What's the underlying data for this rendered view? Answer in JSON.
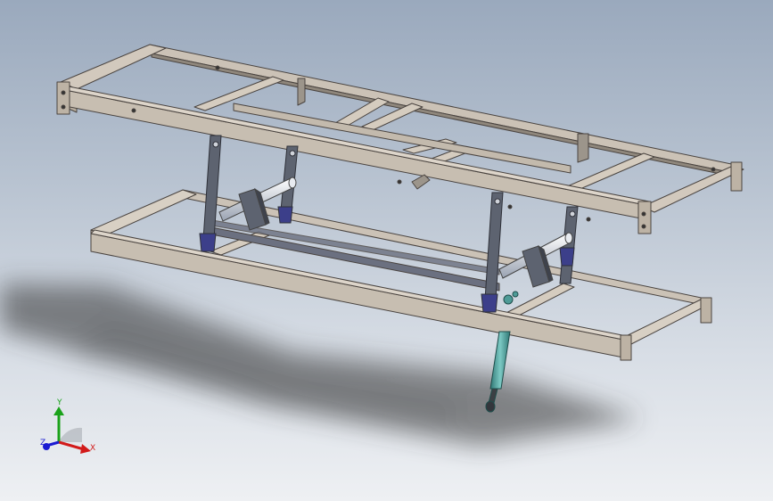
{
  "viewport": {
    "background_top": "#9aa9bd",
    "background_bottom": "#eef0f3"
  },
  "model": {
    "frame_color": "#c9c0b4",
    "frame_edge_color": "#4a4440",
    "link_color": "#5d6370",
    "bracket_color": "#3c3f8a",
    "rod_color": "#dfe3ea",
    "actuator_color": "#5aa9a6"
  },
  "triad": {
    "x_label": "X",
    "y_label": "Y",
    "z_label": "Z",
    "x_color": "#d21a1a",
    "y_color": "#1aa21a",
    "z_color": "#1a1ad2"
  }
}
